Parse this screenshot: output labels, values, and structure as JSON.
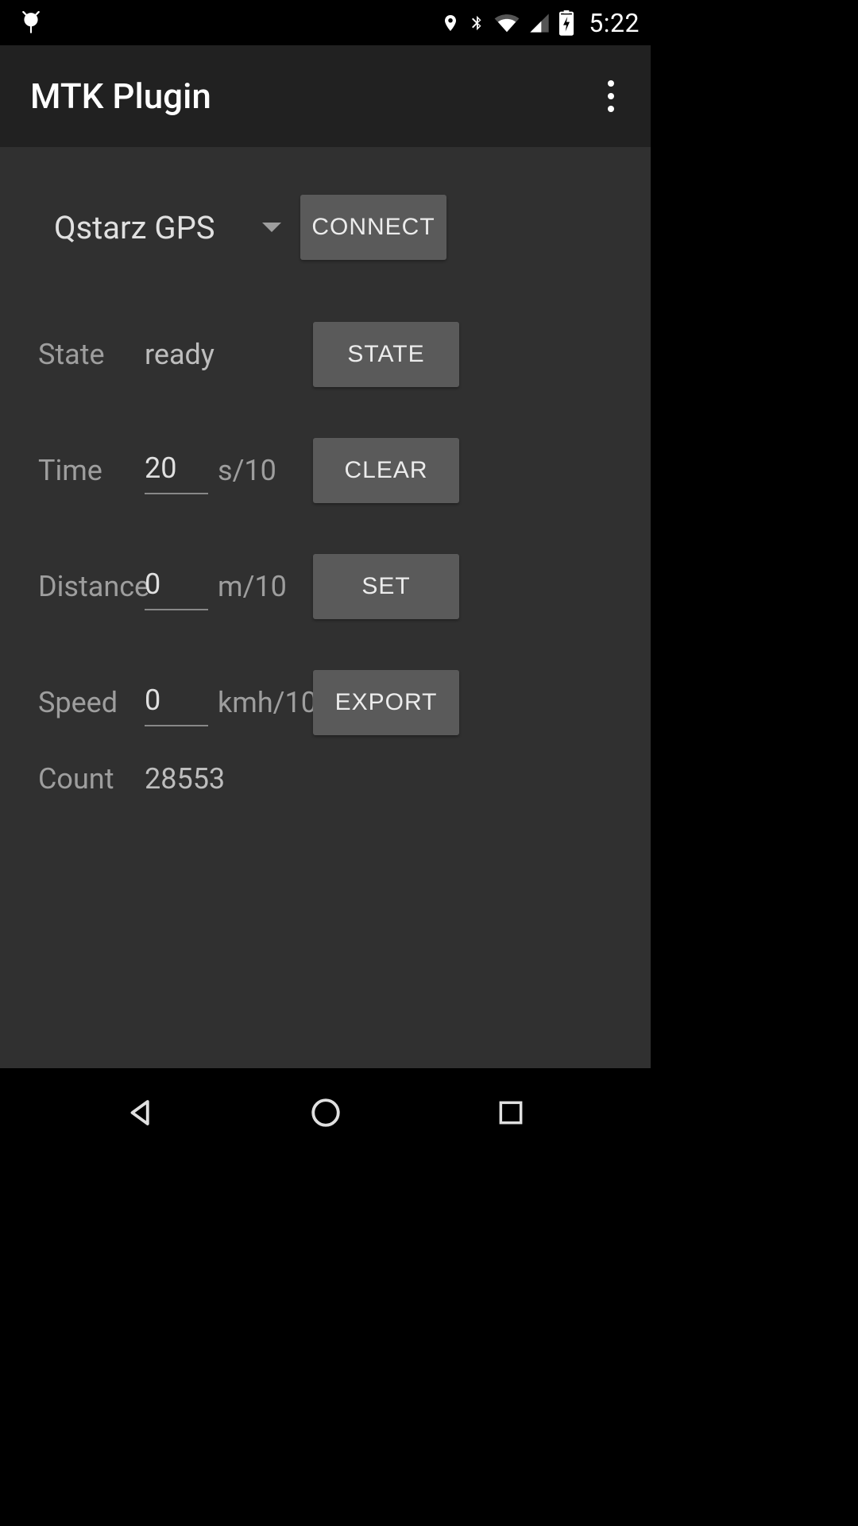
{
  "status": {
    "time": "5:22"
  },
  "header": {
    "title": "MTK Plugin"
  },
  "device": {
    "selected": "Qstarz GPS"
  },
  "buttons": {
    "connect": "CONNECT",
    "state": "STATE",
    "clear": "CLEAR",
    "set": "SET",
    "export": "EXPORT"
  },
  "labels": {
    "state": "State",
    "time": "Time",
    "distance": "Distance",
    "speed": "Speed",
    "count": "Count"
  },
  "units": {
    "time": "s/10",
    "distance": "m/10",
    "speed": "kmh/10"
  },
  "values": {
    "state": "ready",
    "time": "20",
    "distance": "0",
    "speed": "0",
    "count": "28553"
  }
}
